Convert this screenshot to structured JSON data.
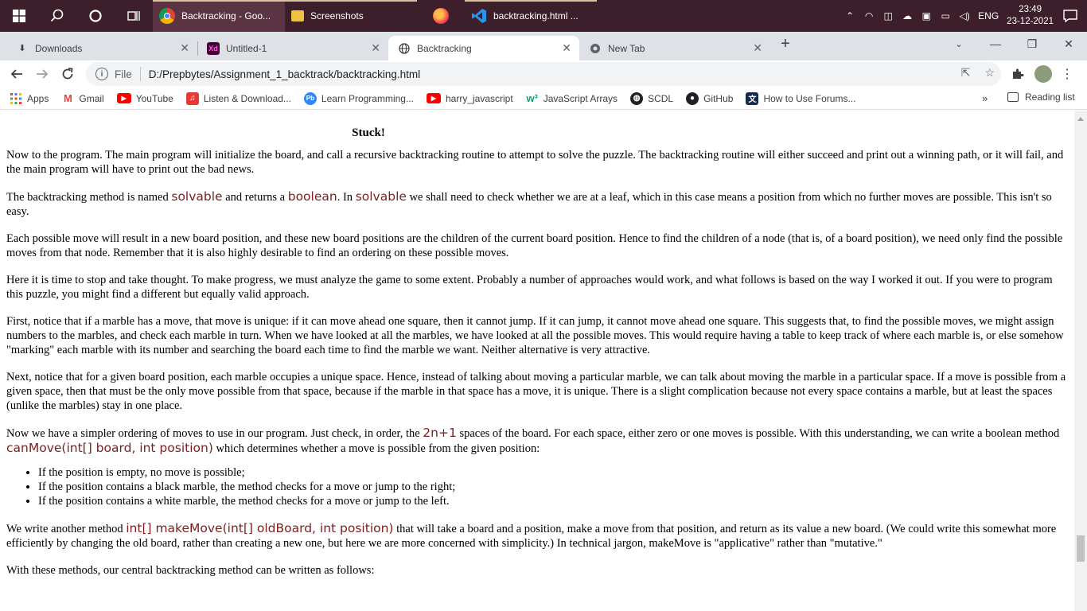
{
  "taskbar": {
    "apps": [
      {
        "label": "Backtracking - Goo...",
        "icon": "chrome-icon"
      },
      {
        "label": "Screenshots",
        "icon": "folder-icon"
      },
      {
        "label": "",
        "icon": "firefox-icon"
      },
      {
        "label": "backtracking.html ...",
        "icon": "vscode-icon"
      }
    ],
    "lang": "ENG",
    "time": "23:49",
    "date": "23-12-2021"
  },
  "tabs": [
    {
      "label": "Downloads"
    },
    {
      "label": "Untitled-1"
    },
    {
      "label": "Backtracking"
    },
    {
      "label": "New Tab"
    }
  ],
  "toolbar": {
    "file_label": "File",
    "url": "D:/Prepbytes/Assignment_1_backtrack/backtracking.html"
  },
  "bookmarks": {
    "items": [
      {
        "label": "Apps"
      },
      {
        "label": "Gmail"
      },
      {
        "label": "YouTube"
      },
      {
        "label": "Listen & Download..."
      },
      {
        "label": "Learn Programming..."
      },
      {
        "label": "harry_javascript"
      },
      {
        "label": "JavaScript Arrays"
      },
      {
        "label": "SCDL"
      },
      {
        "label": "GitHub"
      },
      {
        "label": "How to Use Forums..."
      }
    ],
    "more": "»",
    "reading_list": "Reading list"
  },
  "content": {
    "heading": "Stuck!",
    "p1": "Now to the program. The main program will initialize the board, and call a recursive backtracking routine to attempt to solve the puzzle. The backtracking routine will either succeed and print out a winning path, or it will fail, and the main program will have to print out the bad news.",
    "p2": {
      "a": "The backtracking method is named ",
      "code1": "solvable",
      "b": " and returns a ",
      "code2": "boolean",
      "c": ". In ",
      "code3": "solvable",
      "d": " we shall need to check whether we are at a leaf, which in this case means a position from which no further moves are possible. This isn't so easy."
    },
    "p3": "Each possible move will result in a new board position, and these new board positions are the children of the current board position. Hence to find the children of a node (that is, of a board position), we need only find the possible moves from that node. Remember that it is also highly desirable to find an ordering on these possible moves.",
    "p4": "Here it is time to stop and take thought. To make progress, we must analyze the game to some extent. Probably a number of approaches would work, and what follows is based on the way I worked it out. If you were to program this puzzle, you might find a different but equally valid approach.",
    "p5": "First, notice that if a marble has a move, that move is unique: if it can move ahead one square, then it cannot jump. If it can jump, it cannot move ahead one square. This suggests that, to find the possible moves, we might assign numbers to the marbles, and check each marble in turn. When we have looked at all the marbles, we have looked at all the possible moves. This would require having a table to keep track of where each marble is, or else somehow \"marking\" each marble with its number and searching the board each time to find the marble we want. Neither alternative is very attractive.",
    "p6": "Next, notice that for a given board position, each marble occupies a unique space. Hence, instead of talking about moving a particular marble, we can talk about moving the marble in a particular space. If a move is possible from a given space, then that must be the only move possible from that space, because if the marble in that space has a move, it is unique. There is a slight complication because not every space contains a marble, but at least the spaces (unlike the marbles) stay in one place.",
    "p7": {
      "a": "Now we have a simpler ordering of moves to use in our program. Just check, in order, the ",
      "code1": "2n+1",
      "b": " spaces of the board. For each space, either zero or one moves is possible. With this understanding, we can write a boolean method ",
      "code2": "canMove(int[] board, int position)",
      "c": " which determines whether a move is possible from the given position:"
    },
    "list": [
      "If the position is empty, no move is possible;",
      "If the position contains a black marble, the method checks for a move or jump to the right;",
      "If the position contains a white marble, the method checks for a move or jump to the left."
    ],
    "p8": {
      "a": "We write another method ",
      "code1": "int[] makeMove(int[] oldBoard, int position)",
      "b": " that will take a board and a position, make a move from that position, and return as its value a new board. (We could write this somewhat more efficiently by changing the old board, rather than creating a new one, but here we are more concerned with simplicity.) In technical jargon, makeMove is \"applicative\" rather than \"mutative.\""
    },
    "p9": "With these methods, our central backtracking method can be written as follows:"
  },
  "colors": {
    "taskbar": "#3c1f2b",
    "code_text": "#7a1f1f"
  }
}
